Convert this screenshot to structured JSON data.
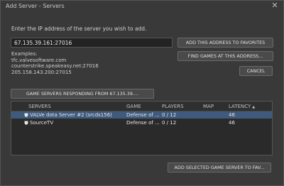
{
  "window": {
    "title": "Add Server - Servers",
    "close_glyph": "✕"
  },
  "form": {
    "instruction": "Enter the IP address of the server you wish to add.",
    "ip_value": "67.135.39.161:27016",
    "examples_label": "Examples:",
    "examples": [
      "tfc.valvesoftware.com",
      "counterstrike.speakeasy.net:27016",
      "205.158.143.200:27015"
    ]
  },
  "buttons": {
    "add_to_favorites": "ADD THIS ADDRESS TO FAVORITES",
    "find_games": "FIND GAMES AT THIS ADDRESS...",
    "cancel": "CANCEL",
    "responding": "GAME SERVERS RESPONDING FROM 67.135.39....",
    "add_selected": "ADD SELECTED GAME SERVER TO FAV..."
  },
  "table": {
    "columns": {
      "servers": "SERVERS",
      "game": "GAME",
      "players": "PLAYERS",
      "map": "MAP",
      "latency": "LATENCY",
      "latency_sort_icon": "▲"
    },
    "rows": [
      {
        "name": "VALVe dota Server #2 (srcds156)",
        "game": "Defense of ...",
        "players": "0 / 12",
        "map": "",
        "latency": "46",
        "selected": true,
        "icon": "shield-icon"
      },
      {
        "name": "SourceTV",
        "game": "Defense of ...",
        "players": "0 / 12",
        "map": "",
        "latency": "46",
        "selected": false,
        "icon": "shield-icon"
      }
    ]
  },
  "colors": {
    "background": "#393939",
    "selection": "#3f5a7d",
    "text": "#d4d4d4"
  }
}
